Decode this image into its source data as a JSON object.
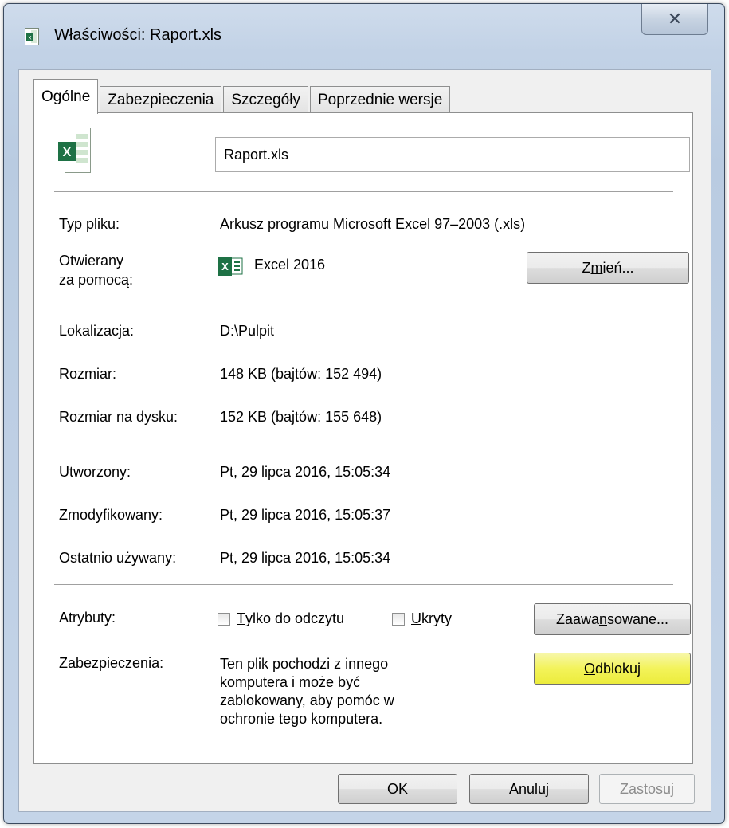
{
  "window": {
    "title": "Właściwości: Raport.xls",
    "close_glyph": "✕"
  },
  "tabs": [
    {
      "label": "Ogólne",
      "active": true
    },
    {
      "label": "Zabezpieczenia",
      "active": false
    },
    {
      "label": "Szczegóły",
      "active": false
    },
    {
      "label": "Poprzednie wersje",
      "active": false
    }
  ],
  "general": {
    "file_name": "Raport.xls",
    "type_label": "Typ pliku:",
    "type_value": "Arkusz programu Microsoft Excel 97–2003 (.xls)",
    "opens_with_label_1": "Otwierany",
    "opens_with_label_2": "za pomocą:",
    "opens_with_value": "Excel 2016",
    "change_button": {
      "pre": "Z",
      "underlined": "m",
      "post": "ień..."
    },
    "location_label": "Lokalizacja:",
    "location_value": "D:\\Pulpit",
    "size_label": "Rozmiar:",
    "size_value": "148 KB (bajtów: 152 494)",
    "size_on_disk_label": "Rozmiar na dysku:",
    "size_on_disk_value": "152 KB (bajtów: 155 648)",
    "created_label": "Utworzony:",
    "created_value": "Pt, 29 lipca 2016, 15:05:34",
    "modified_label": "Zmodyfikowany:",
    "modified_value": "Pt, 29 lipca 2016, 15:05:37",
    "accessed_label": "Ostatnio używany:",
    "accessed_value": "Pt, 29 lipca 2016, 15:05:34",
    "attributes_label": "Atrybuty:",
    "readonly": {
      "pre": "",
      "underlined": "T",
      "post": "ylko do odczytu",
      "checked": false
    },
    "hidden": {
      "pre": "",
      "underlined": "U",
      "post": "kryty",
      "checked": false
    },
    "advanced_button": {
      "pre": "Zaawa",
      "underlined": "n",
      "post": "sowane..."
    },
    "security_label": "Zabezpieczenia:",
    "security_lines": [
      "Ten plik pochodzi z innego",
      "komputera i może być",
      "zablokowany, aby pomóc w",
      "ochronie tego komputera."
    ],
    "unblock_button": {
      "pre": "",
      "underlined": "O",
      "post": "dblokuj"
    }
  },
  "footer": {
    "ok": "OK",
    "cancel": "Anuluj",
    "apply": {
      "pre": "",
      "underlined": "Z",
      "post": "astosuj"
    }
  },
  "colors": {
    "highlight": "#f3f35a",
    "excel_green": "#1e7145"
  }
}
